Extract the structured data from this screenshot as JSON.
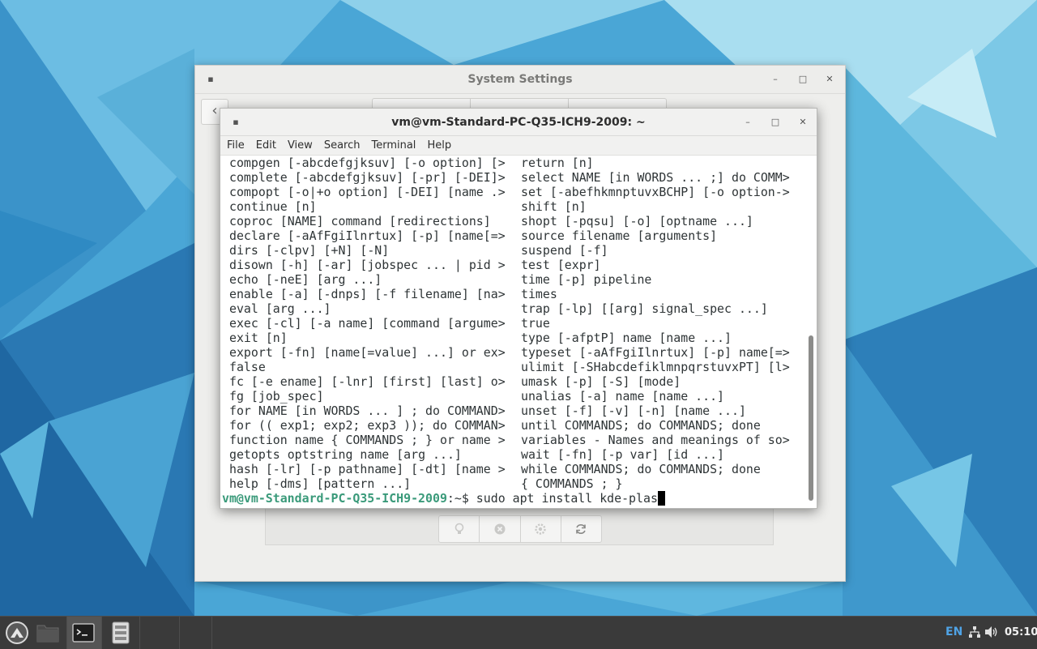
{
  "desktop": {
    "wallpaper_colors": [
      "#2f86c3",
      "#5ab4de",
      "#8fd3ea",
      "#3a9fd3",
      "#6ac1e3",
      "#b7e4f0",
      "#1f6fae",
      "#4fb5cf"
    ]
  },
  "settings_window": {
    "title": "System Settings",
    "back_icon": "chevron-left-icon",
    "toolbar_icons": [
      "lightbulb-icon",
      "close-circle-icon",
      "gear-icon",
      "refresh-icon"
    ]
  },
  "terminal": {
    "title": "vm@vm-Standard-PC-Q35-ICH9-2009: ~",
    "menu": [
      "File",
      "Edit",
      "View",
      "Search",
      "Terminal",
      "Help"
    ],
    "rows": [
      {
        "left": "compgen [-abcdefgjksuv] [-o option] [>",
        "right": "return [n]"
      },
      {
        "left": "complete [-abcdefgjksuv] [-pr] [-DEI]>",
        "right": "select NAME [in WORDS ... ;] do COMM>"
      },
      {
        "left": "compopt [-o|+o option] [-DEI] [name .>",
        "right": "set [-abefhkmnptuvxBCHP] [-o option->"
      },
      {
        "left": "continue [n]",
        "right": "shift [n]"
      },
      {
        "left": "coproc [NAME] command [redirections]",
        "right": "shopt [-pqsu] [-o] [optname ...]"
      },
      {
        "left": "declare [-aAfFgiIlnrtux] [-p] [name[=>",
        "right": "source filename [arguments]"
      },
      {
        "left": "dirs [-clpv] [+N] [-N]",
        "right": "suspend [-f]"
      },
      {
        "left": "disown [-h] [-ar] [jobspec ... | pid >",
        "right": "test [expr]"
      },
      {
        "left": "echo [-neE] [arg ...]",
        "right": "time [-p] pipeline"
      },
      {
        "left": "enable [-a] [-dnps] [-f filename] [na>",
        "right": "times"
      },
      {
        "left": "eval [arg ...]",
        "right": "trap [-lp] [[arg] signal_spec ...]"
      },
      {
        "left": "exec [-cl] [-a name] [command [argume>",
        "right": "true"
      },
      {
        "left": "exit [n]",
        "right": "type [-afptP] name [name ...]"
      },
      {
        "left": "export [-fn] [name[=value] ...] or ex>",
        "right": "typeset [-aAfFgiIlnrtux] [-p] name[=>"
      },
      {
        "left": "false",
        "right": "ulimit [-SHabcdefiklmnpqrstuvxPT] [l>"
      },
      {
        "left": "fc [-e ename] [-lnr] [first] [last] o>",
        "right": "umask [-p] [-S] [mode]"
      },
      {
        "left": "fg [job_spec]",
        "right": "unalias [-a] name [name ...]"
      },
      {
        "left": "for NAME [in WORDS ... ] ; do COMMAND>",
        "right": "unset [-f] [-v] [-n] [name ...]"
      },
      {
        "left": "for (( exp1; exp2; exp3 )); do COMMAN>",
        "right": "until COMMANDS; do COMMANDS; done"
      },
      {
        "left": "function name { COMMANDS ; } or name >",
        "right": "variables - Names and meanings of so>"
      },
      {
        "left": "getopts optstring name [arg ...]",
        "right": "wait [-fn] [-p var] [id ...]"
      },
      {
        "left": "hash [-lr] [-p pathname] [-dt] [name >",
        "right": "while COMMANDS; do COMMANDS; done"
      },
      {
        "left": "help [-dms] [pattern ...]",
        "right": "{ COMMANDS ; }"
      }
    ],
    "prompt": {
      "user_host": "vm@vm-Standard-PC-Q35-ICH9-2009",
      "path": ":~",
      "symbol": "$ ",
      "command": "sudo apt install kde-plas"
    }
  },
  "taskbar": {
    "launchers": [
      "app-menu-icon",
      "file-manager-icon",
      "terminal-icon",
      "archive-icon"
    ],
    "tray": {
      "language": "EN",
      "network_icon": "network-icon",
      "volume_icon": "volume-icon",
      "clock": "05:10"
    }
  }
}
